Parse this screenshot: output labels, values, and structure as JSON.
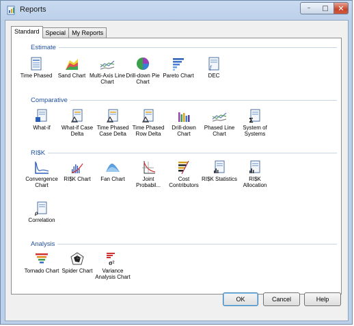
{
  "window": {
    "title": "Reports",
    "close_glyph": "✕",
    "minimize_glyph": "–",
    "maximize_glyph": "□"
  },
  "tabs": [
    {
      "label": "Standard",
      "active": true
    },
    {
      "label": "Special",
      "active": false
    },
    {
      "label": "My Reports",
      "active": false
    }
  ],
  "sections": {
    "estimate": {
      "title": "Estimate",
      "items": [
        {
          "label": "Time Phased",
          "icon": "report-doc-icon"
        },
        {
          "label": "Sand Chart",
          "icon": "sand-chart-icon"
        },
        {
          "label": "Multi-Axis Line Chart",
          "icon": "multi-line-chart-icon"
        },
        {
          "label": "Drill-down Pie Chart",
          "icon": "pie-chart-icon"
        },
        {
          "label": "Pareto Chart",
          "icon": "pareto-chart-icon"
        },
        {
          "label": "DEC",
          "icon": "dec-doc-icon"
        }
      ]
    },
    "comparative": {
      "title": "Comparative",
      "items": [
        {
          "label": "What-if",
          "icon": "report-doc-icon"
        },
        {
          "label": "What-if Case Delta",
          "icon": "delta-doc-icon"
        },
        {
          "label": "Time Phased Case Delta",
          "icon": "delta-doc-icon"
        },
        {
          "label": "Time Phased Row Delta",
          "icon": "delta-doc-icon"
        },
        {
          "label": "Drill-down Chart",
          "icon": "bar-chart-icon"
        },
        {
          "label": "Phased Line Chart",
          "icon": "multi-line-chart-icon"
        },
        {
          "label": "System of Systems",
          "icon": "sigma-doc-icon"
        }
      ]
    },
    "risk": {
      "title": "RI$K",
      "items": [
        {
          "label": "Convergence Chart",
          "icon": "convergence-chart-icon"
        },
        {
          "label": "RI$K Chart",
          "icon": "risk-chart-icon"
        },
        {
          "label": "Fan Chart",
          "icon": "fan-chart-icon"
        },
        {
          "label": "Joint Probabil...",
          "icon": "joint-probability-icon"
        },
        {
          "label": "Cost Contributors",
          "icon": "cost-contributors-icon"
        },
        {
          "label": "RI$K Statistics",
          "icon": "stats-doc-icon"
        },
        {
          "label": "RI$K Allocation",
          "icon": "stats-doc-icon"
        },
        {
          "label": "Correlation",
          "icon": "correlation-doc-icon"
        }
      ]
    },
    "analysis": {
      "title": "Analysis",
      "items": [
        {
          "label": "Tornado Chart",
          "icon": "tornado-chart-icon"
        },
        {
          "label": "Spider Chart",
          "icon": "spider-chart-icon"
        },
        {
          "label": "Variance Analysis Chart",
          "icon": "variance-chart-icon"
        }
      ]
    }
  },
  "buttons": {
    "ok": "OK",
    "cancel": "Cancel",
    "help": "Help"
  }
}
